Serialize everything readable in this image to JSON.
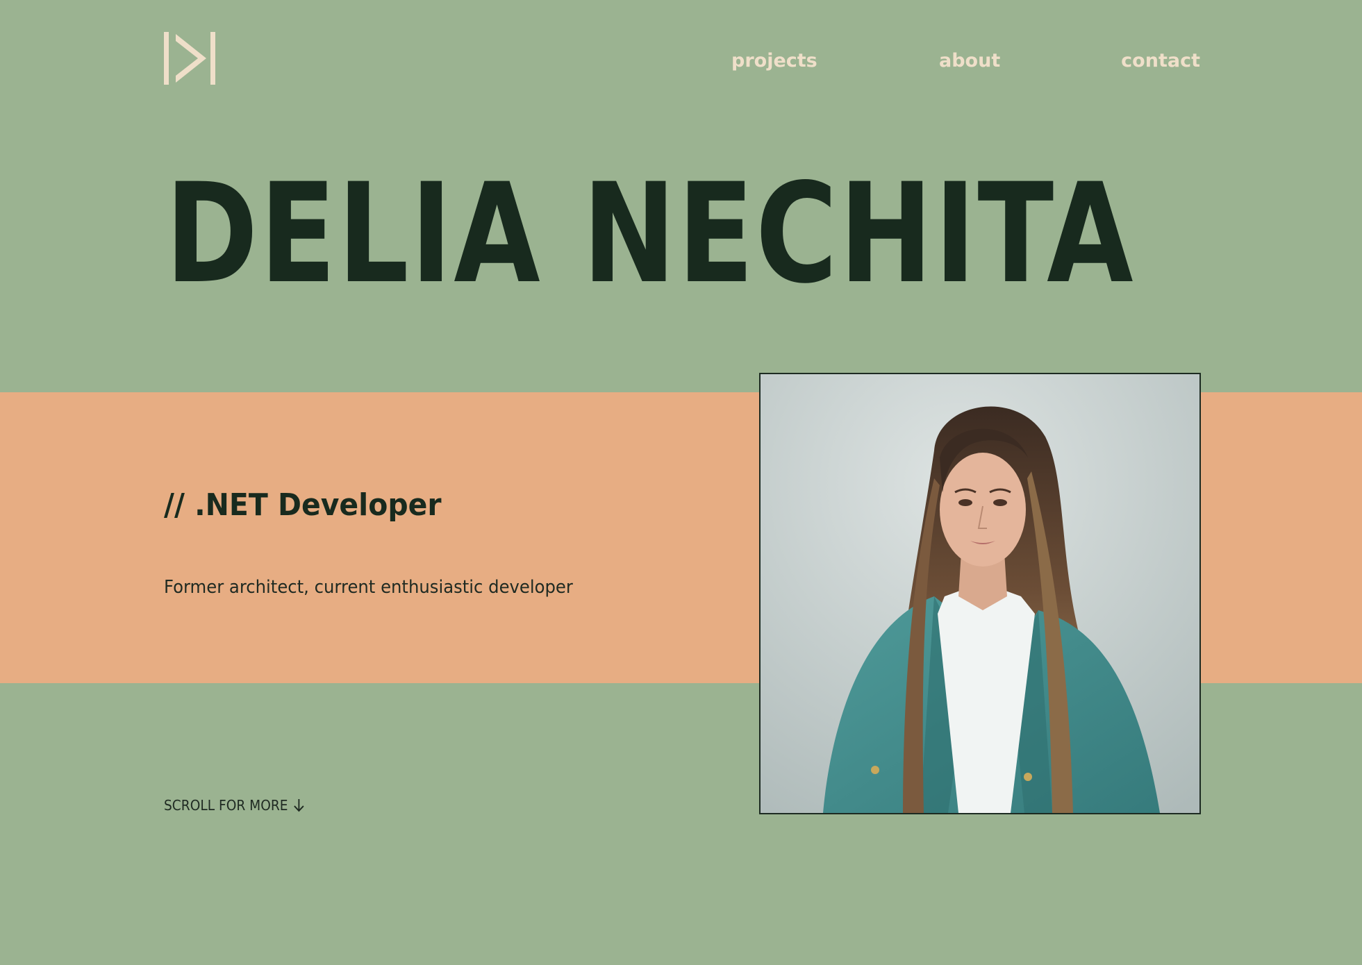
{
  "header": {
    "logo_name": "brand-logo",
    "nav": [
      {
        "label": "projects"
      },
      {
        "label": "about"
      },
      {
        "label": "contact"
      }
    ]
  },
  "hero": {
    "name": "DELIA NECHITA",
    "role": "// .NET Developer",
    "tagline": "Former architect, current enthusiastic developer",
    "scroll_label": "SCROLL FOR MORE",
    "scroll_icon": "arrow-down-icon"
  },
  "colors": {
    "background": "#9bb391",
    "band": "#e7ad83",
    "text_dark": "#182a1e",
    "nav_text": "#efdfc9"
  }
}
